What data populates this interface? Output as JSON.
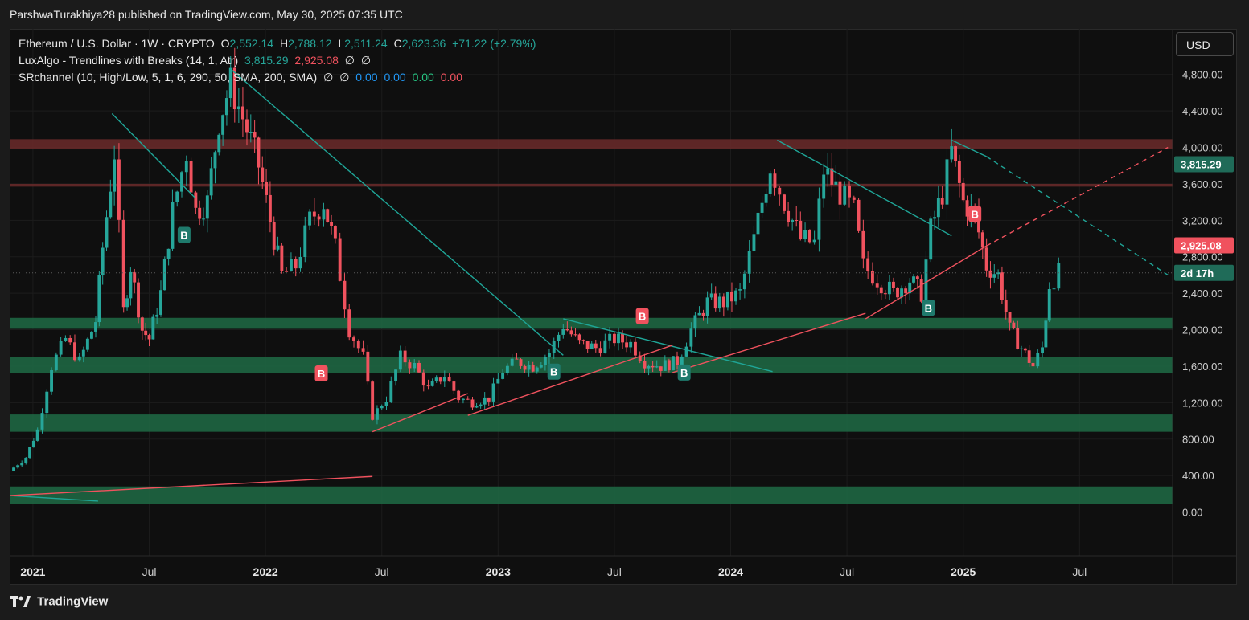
{
  "header": {
    "published": "ParshwaTurakhiya28 published on TradingView.com, May 30, 2025 07:35 UTC"
  },
  "legend": {
    "row1": {
      "symbol": "Ethereum / U.S. Dollar · 1W · CRYPTO",
      "o_label": "O",
      "o": "2,552.14",
      "h_label": "H",
      "h": "2,788.12",
      "l_label": "L",
      "l": "2,511.24",
      "c_label": "C",
      "c": "2,623.36",
      "change": "+71.22 (+2.79%)"
    },
    "row2": {
      "name": "LuxAlgo - Trendlines with Breaks (14, 1, Atr)",
      "v1": "3,815.29",
      "v2": "2,925.08",
      "v3": "∅",
      "v4": "∅"
    },
    "row3": {
      "name": "SRchannel (10, High/Low, 5, 1, 6, 290, 50, SMA, 200, SMA)",
      "v1": "∅",
      "v2": "∅",
      "v3": "0.00",
      "v4": "0.00",
      "v5": "0.00",
      "v6": "0.00"
    }
  },
  "currency_button": "USD",
  "footer": {
    "brand": "TradingView"
  },
  "colors": {
    "up": "#26a69a",
    "down": "#f0525e",
    "zone_support": "#1f6b45",
    "zone_resist": "#6b2a2a",
    "trend_teal": "#1fa597",
    "trend_red": "#f0525e"
  },
  "chart_data": {
    "type": "candlestick",
    "y_ticks": [
      "0.00",
      "400.00",
      "800.00",
      "1,200.00",
      "1,600.00",
      "2,000.00",
      "2,400.00",
      "2,800.00",
      "3,200.00",
      "3,600.00",
      "4,000.00",
      "4,400.00",
      "4,800.00"
    ],
    "y_tick_values": [
      0,
      400,
      800,
      1200,
      1600,
      2000,
      2400,
      2800,
      3200,
      3600,
      4000,
      4400,
      4800
    ],
    "ylim": [
      -480,
      5300
    ],
    "x_range": [
      2020.9,
      2025.9
    ],
    "x_ticks": [
      {
        "label": "2021",
        "t": 2021.0,
        "year": true
      },
      {
        "label": "Jul",
        "t": 2021.5,
        "year": false
      },
      {
        "label": "2022",
        "t": 2022.0,
        "year": true
      },
      {
        "label": "Jul",
        "t": 2022.5,
        "year": false
      },
      {
        "label": "2023",
        "t": 2023.0,
        "year": true
      },
      {
        "label": "Jul",
        "t": 2023.5,
        "year": false
      },
      {
        "label": "2024",
        "t": 2024.0,
        "year": true
      },
      {
        "label": "Jul",
        "t": 2024.5,
        "year": false
      },
      {
        "label": "2025",
        "t": 2025.0,
        "year": true
      },
      {
        "label": "Jul",
        "t": 2025.5,
        "year": false
      }
    ],
    "price_tags": [
      {
        "label": "3,815.29",
        "value": 3815.29,
        "color": "#1f6b58"
      },
      {
        "label": "2,925.08",
        "value": 2925.08,
        "color": "#f0525e"
      },
      {
        "label": "2d 17h",
        "value": 2623.36,
        "color": "#1f6b58"
      }
    ],
    "last_price": 2623.36,
    "zones": [
      {
        "low": 3980,
        "high": 4090,
        "kind": "resistance"
      },
      {
        "low": 3570,
        "high": 3600,
        "kind": "resistance"
      },
      {
        "low": 2010,
        "high": 2130,
        "kind": "support"
      },
      {
        "low": 1520,
        "high": 1700,
        "kind": "support"
      },
      {
        "low": 880,
        "high": 1070,
        "kind": "support"
      },
      {
        "low": 90,
        "high": 280,
        "kind": "support"
      }
    ],
    "trendlines": [
      {
        "color": "teal",
        "dashed": false,
        "points": [
          [
            2021.34,
            4370
          ],
          [
            2021.7,
            3440
          ]
        ]
      },
      {
        "color": "teal",
        "dashed": false,
        "points": [
          [
            2021.85,
            4860
          ],
          [
            2023.28,
            1720
          ]
        ]
      },
      {
        "color": "teal",
        "dashed": false,
        "points": [
          [
            2023.28,
            2120
          ],
          [
            2024.18,
            1540
          ]
        ]
      },
      {
        "color": "teal",
        "dashed": false,
        "points": [
          [
            2024.2,
            4080
          ],
          [
            2024.95,
            3030
          ]
        ]
      },
      {
        "color": "teal",
        "dashed": false,
        "points": [
          [
            2024.95,
            4080
          ],
          [
            2025.1,
            3900
          ]
        ]
      },
      {
        "color": "teal",
        "dashed": true,
        "points": [
          [
            2025.1,
            3900
          ],
          [
            2025.88,
            2600
          ]
        ]
      },
      {
        "color": "teal",
        "dashed": false,
        "points": [
          [
            2020.9,
            180
          ],
          [
            2021.28,
            120
          ]
        ]
      },
      {
        "color": "red",
        "dashed": false,
        "points": [
          [
            2020.9,
            180
          ],
          [
            2022.46,
            390
          ]
        ]
      },
      {
        "color": "red",
        "dashed": false,
        "points": [
          [
            2022.46,
            880
          ],
          [
            2022.87,
            1300
          ]
        ]
      },
      {
        "color": "red",
        "dashed": false,
        "points": [
          [
            2022.87,
            1060
          ],
          [
            2023.75,
            1830
          ]
        ]
      },
      {
        "color": "red",
        "dashed": false,
        "points": [
          [
            2023.75,
            1530
          ],
          [
            2024.58,
            2180
          ]
        ]
      },
      {
        "color": "red",
        "dashed": false,
        "points": [
          [
            2024.58,
            2120
          ],
          [
            2025.1,
            2920
          ]
        ]
      },
      {
        "color": "red",
        "dashed": true,
        "points": [
          [
            2025.1,
            2920
          ],
          [
            2025.88,
            4000
          ]
        ]
      }
    ],
    "break_labels": [
      {
        "t": 2021.65,
        "price": 3040,
        "type": "B",
        "color": "teal"
      },
      {
        "t": 2022.24,
        "price": 1520,
        "type": "B",
        "color": "red"
      },
      {
        "t": 2023.24,
        "price": 1540,
        "type": "B",
        "color": "teal"
      },
      {
        "t": 2023.62,
        "price": 2150,
        "type": "B",
        "color": "red"
      },
      {
        "t": 2023.8,
        "price": 1530,
        "type": "B",
        "color": "teal"
      },
      {
        "t": 2024.85,
        "price": 2240,
        "type": "B",
        "color": "teal"
      },
      {
        "t": 2025.05,
        "price": 3270,
        "type": "B",
        "color": "red"
      }
    ],
    "series": [
      {
        "t": 2020.9,
        "price": 450
      },
      {
        "t": 2020.97,
        "price": 600
      },
      {
        "t": 2021.02,
        "price": 900
      },
      {
        "t": 2021.08,
        "price": 1600
      },
      {
        "t": 2021.14,
        "price": 1900
      },
      {
        "t": 2021.2,
        "price": 1650
      },
      {
        "t": 2021.27,
        "price": 2100
      },
      {
        "t": 2021.3,
        "price": 2900
      },
      {
        "t": 2021.35,
        "price": 3950
      },
      {
        "t": 2021.39,
        "price": 2200
      },
      {
        "t": 2021.42,
        "price": 2700
      },
      {
        "t": 2021.47,
        "price": 2000
      },
      {
        "t": 2021.5,
        "price": 1900
      },
      {
        "t": 2021.55,
        "price": 2400
      },
      {
        "t": 2021.6,
        "price": 3300
      },
      {
        "t": 2021.66,
        "price": 3950
      },
      {
        "t": 2021.7,
        "price": 3300
      },
      {
        "t": 2021.75,
        "price": 3400
      },
      {
        "t": 2021.8,
        "price": 4300
      },
      {
        "t": 2021.85,
        "price": 4700
      },
      {
        "t": 2021.92,
        "price": 4200
      },
      {
        "t": 2021.97,
        "price": 3800
      },
      {
        "t": 2022.02,
        "price": 3200
      },
      {
        "t": 2022.07,
        "price": 2600
      },
      {
        "t": 2022.13,
        "price": 2700
      },
      {
        "t": 2022.19,
        "price": 3200
      },
      {
        "t": 2022.25,
        "price": 3400
      },
      {
        "t": 2022.3,
        "price": 2900
      },
      {
        "t": 2022.36,
        "price": 2000
      },
      {
        "t": 2022.42,
        "price": 1700
      },
      {
        "t": 2022.46,
        "price": 1050
      },
      {
        "t": 2022.52,
        "price": 1250
      },
      {
        "t": 2022.58,
        "price": 1700
      },
      {
        "t": 2022.64,
        "price": 1600
      },
      {
        "t": 2022.7,
        "price": 1350
      },
      {
        "t": 2022.77,
        "price": 1500
      },
      {
        "t": 2022.83,
        "price": 1250
      },
      {
        "t": 2022.89,
        "price": 1200
      },
      {
        "t": 2022.96,
        "price": 1250
      },
      {
        "t": 2023.02,
        "price": 1550
      },
      {
        "t": 2023.08,
        "price": 1650
      },
      {
        "t": 2023.15,
        "price": 1600
      },
      {
        "t": 2023.22,
        "price": 1750
      },
      {
        "t": 2023.28,
        "price": 2050
      },
      {
        "t": 2023.35,
        "price": 1850
      },
      {
        "t": 2023.42,
        "price": 1800
      },
      {
        "t": 2023.5,
        "price": 1900
      },
      {
        "t": 2023.57,
        "price": 1850
      },
      {
        "t": 2023.63,
        "price": 1650
      },
      {
        "t": 2023.7,
        "price": 1600
      },
      {
        "t": 2023.77,
        "price": 1650
      },
      {
        "t": 2023.83,
        "price": 2000
      },
      {
        "t": 2023.9,
        "price": 2300
      },
      {
        "t": 2023.97,
        "price": 2300
      },
      {
        "t": 2024.04,
        "price": 2400
      },
      {
        "t": 2024.1,
        "price": 3000
      },
      {
        "t": 2024.17,
        "price": 3800
      },
      {
        "t": 2024.23,
        "price": 3400
      },
      {
        "t": 2024.3,
        "price": 3000
      },
      {
        "t": 2024.36,
        "price": 2950
      },
      {
        "t": 2024.4,
        "price": 3750
      },
      {
        "t": 2024.47,
        "price": 3500
      },
      {
        "t": 2024.53,
        "price": 3300
      },
      {
        "t": 2024.57,
        "price": 2700
      },
      {
        "t": 2024.63,
        "price": 2550
      },
      {
        "t": 2024.7,
        "price": 2400
      },
      {
        "t": 2024.77,
        "price": 2550
      },
      {
        "t": 2024.82,
        "price": 2400
      },
      {
        "t": 2024.86,
        "price": 3100
      },
      {
        "t": 2024.91,
        "price": 3500
      },
      {
        "t": 2024.95,
        "price": 3950
      },
      {
        "t": 2025.0,
        "price": 3400
      },
      {
        "t": 2025.05,
        "price": 3250
      },
      {
        "t": 2025.1,
        "price": 2700
      },
      {
        "t": 2025.15,
        "price": 2600
      },
      {
        "t": 2025.2,
        "price": 2000
      },
      {
        "t": 2025.25,
        "price": 1800
      },
      {
        "t": 2025.3,
        "price": 1600
      },
      {
        "t": 2025.34,
        "price": 1800
      },
      {
        "t": 2025.37,
        "price": 2500
      },
      {
        "t": 2025.41,
        "price": 2623
      }
    ]
  }
}
